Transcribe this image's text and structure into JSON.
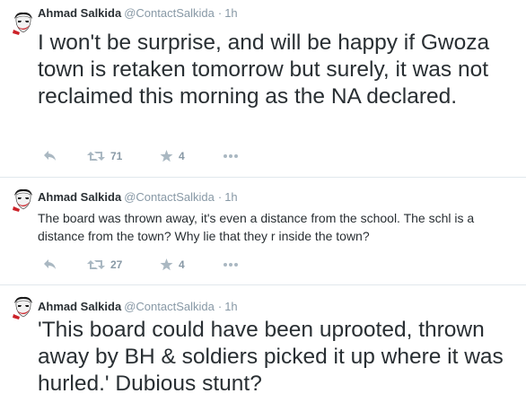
{
  "tweets": [
    {
      "fullname": "Ahmad Salkida",
      "username": "@ContactSalkida",
      "separator": "·",
      "time": "1h",
      "text": "I won't be surprise, and will be happy if Gwoza town is retaken tomorrow but surely, it was not reclaimed this morning as the NA declared.",
      "retweets": "71",
      "favorites": "4"
    },
    {
      "fullname": "Ahmad Salkida",
      "username": "@ContactSalkida",
      "separator": "·",
      "time": "1h",
      "text": "The board was thrown away, it's even a distance from the school. The schl is a distance from the town? Why lie that they r inside the town?",
      "retweets": "27",
      "favorites": "4"
    },
    {
      "fullname": "Ahmad Salkida",
      "username": "@ContactSalkida",
      "separator": "·",
      "time": "1h",
      "text": "'This board could have been uprooted, thrown away by BH & soldiers picked it up where it was hurled.' Dubious stunt?"
    }
  ],
  "icons": {
    "reply": "reply-icon",
    "retweet": "retweet-icon",
    "favorite": "star-icon",
    "more": "more-dots-icon",
    "avatar": "avatar-joker-icon"
  },
  "colors": {
    "text": "#292f33",
    "meta": "#8899a6",
    "action_icon": "#aab8c2",
    "divider": "#e1e8ed",
    "avatar_accent": "#cc2229"
  }
}
